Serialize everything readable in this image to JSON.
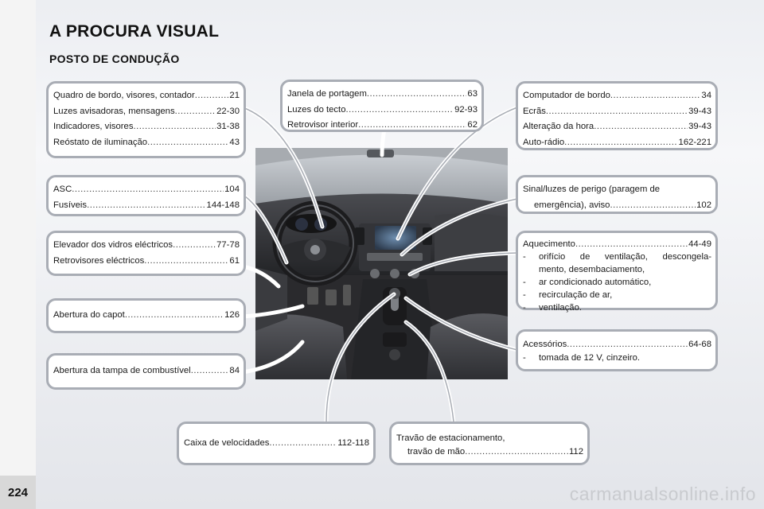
{
  "page_number": "224",
  "title": "A PROCURA VISUAL",
  "subtitle": "POSTO DE CONDUÇÃO",
  "boxes": {
    "quadro": [
      {
        "label": "Quadro de bordo, visores, contador",
        "page": "21"
      },
      {
        "label": "Luzes avisadoras, mensagens",
        "page": "22-30"
      },
      {
        "label": "Indicadores, visores",
        "page": "31-38"
      },
      {
        "label": "Reóstato de iluminação",
        "page": "43"
      }
    ],
    "janela": [
      {
        "label": "Janela de portagem",
        "page": "63"
      },
      {
        "label": "Luzes do tecto",
        "page": "92-93"
      },
      {
        "label": "Retrovisor interior",
        "page": "62"
      }
    ],
    "computador": [
      {
        "label": "Computador de bordo",
        "page": "34"
      },
      {
        "label": "Ecrãs",
        "page": "39-43"
      },
      {
        "label": "Alteração da hora",
        "page": "39-43"
      },
      {
        "label": "Auto-rádio",
        "page": "162-221"
      }
    ],
    "asc": [
      {
        "label": "ASC",
        "page": "104"
      },
      {
        "label": "Fusíveis",
        "page": "144-148"
      }
    ],
    "sinal": {
      "line1": "Sinal/luzes de perigo (paragem de",
      "line2": "emergência), aviso",
      "page": "102"
    },
    "elevador": [
      {
        "label": "Elevador dos vidros eléctricos",
        "page": "77-78"
      },
      {
        "label": "Retrovisores eléctricos",
        "page": "61"
      }
    ],
    "aquecimento": {
      "label": "Aquecimento",
      "page": "44-49",
      "items": [
        {
          "dash": "-",
          "line1": "orifício de ventilação, descongela-",
          "line2": "mento, desembaciamento,"
        },
        {
          "dash": "-",
          "line1": "ar condicionado automático,"
        },
        {
          "dash": "-",
          "line1": "recirculação de ar,"
        },
        {
          "dash": "-",
          "line1": "ventilação."
        }
      ]
    },
    "capot": [
      {
        "label": "Abertura do capot",
        "page": "126"
      }
    ],
    "acessorios": {
      "label": "Acessórios",
      "page": "64-68",
      "items": [
        {
          "dash": "-",
          "line1": "tomada de 12 V, cinzeiro."
        }
      ]
    },
    "tampa": [
      {
        "label": "Abertura da tampa de combustível",
        "page": "84"
      }
    ],
    "caixa": [
      {
        "label": "Caixa de velocidades",
        "page": "112-118"
      }
    ],
    "travao": {
      "line1": "Travão de estacionamento,",
      "line2": "travão de mão",
      "page": "112"
    }
  },
  "watermark": "carmanualsonline.info",
  "colors": {
    "box_border": "#a9adb5",
    "connector": "#ffffff",
    "page_bg": "#eceef2"
  }
}
